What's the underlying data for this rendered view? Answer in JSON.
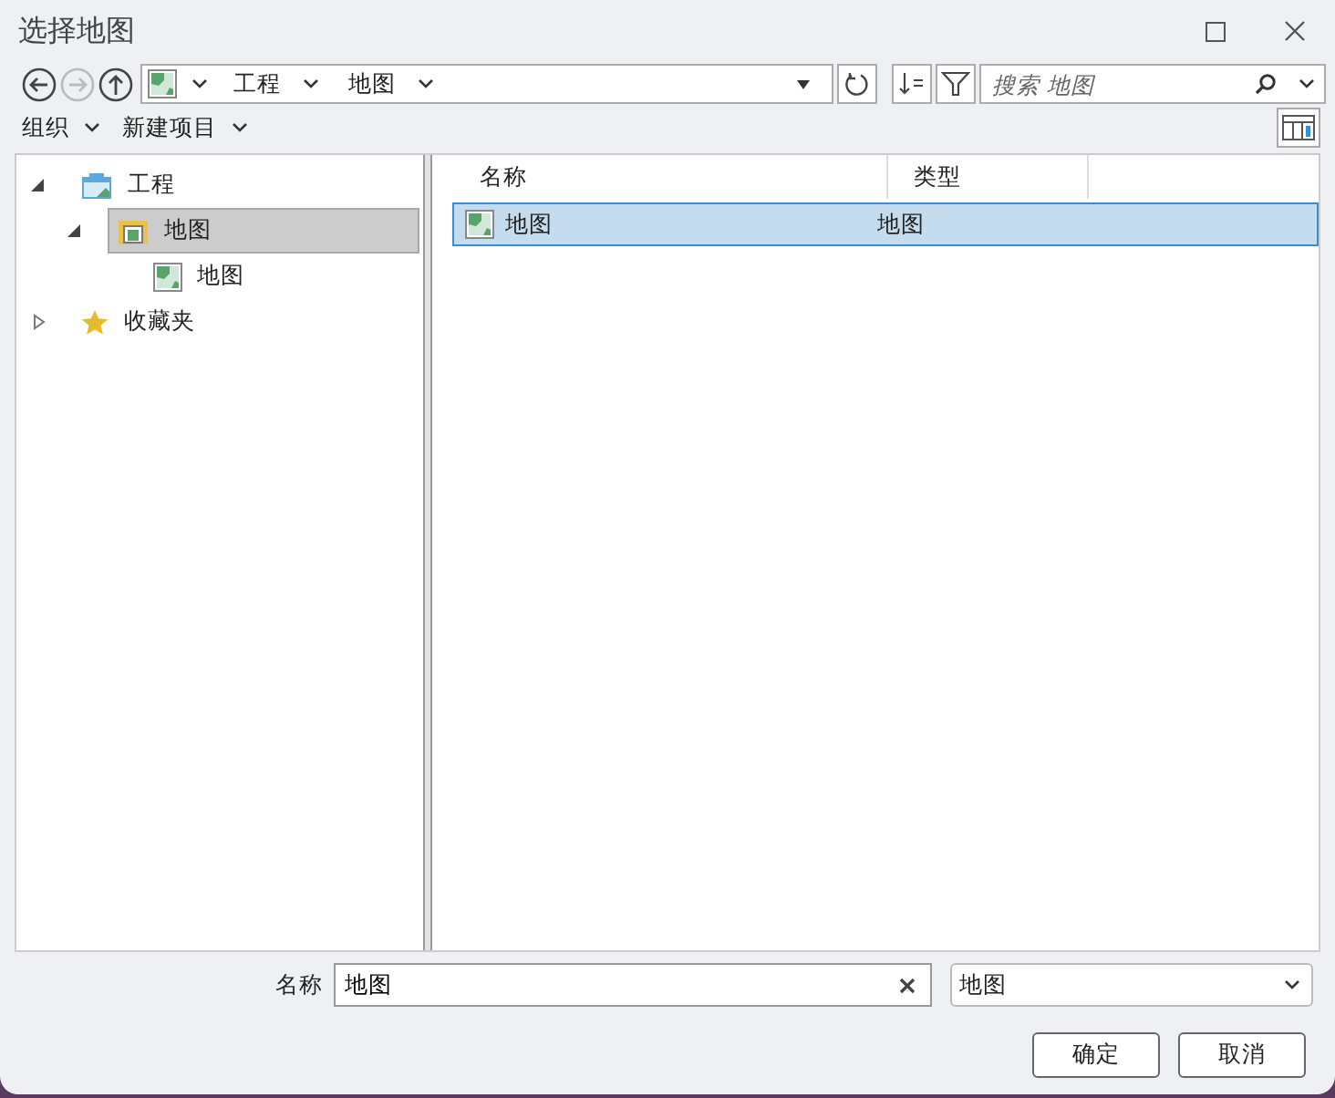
{
  "window": {
    "title": "选择地图"
  },
  "breadcrumb": [
    {
      "label": "工程"
    },
    {
      "label": "地图"
    }
  ],
  "search": {
    "placeholder": "搜索 地图"
  },
  "toolbar": [
    "组织",
    "新建项目"
  ],
  "tree": [
    {
      "label": "工程",
      "kind": "project",
      "expanded": true,
      "selected": false,
      "children": [
        {
          "label": "地图",
          "kind": "folder",
          "expanded": true,
          "selected": true,
          "children": [
            {
              "label": "地图",
              "kind": "map",
              "selected": false
            }
          ]
        }
      ]
    },
    {
      "label": "收藏夹",
      "kind": "star",
      "expanded": false,
      "selected": false
    }
  ],
  "table": {
    "columns": [
      "名称",
      "类型"
    ],
    "rows": [
      {
        "name": "地图",
        "type": "地图",
        "selected": true
      }
    ]
  },
  "name_field": {
    "label": "名称",
    "value": "地图"
  },
  "type_dropdown": {
    "value": "地图"
  },
  "buttons": [
    "确定",
    "取消"
  ]
}
